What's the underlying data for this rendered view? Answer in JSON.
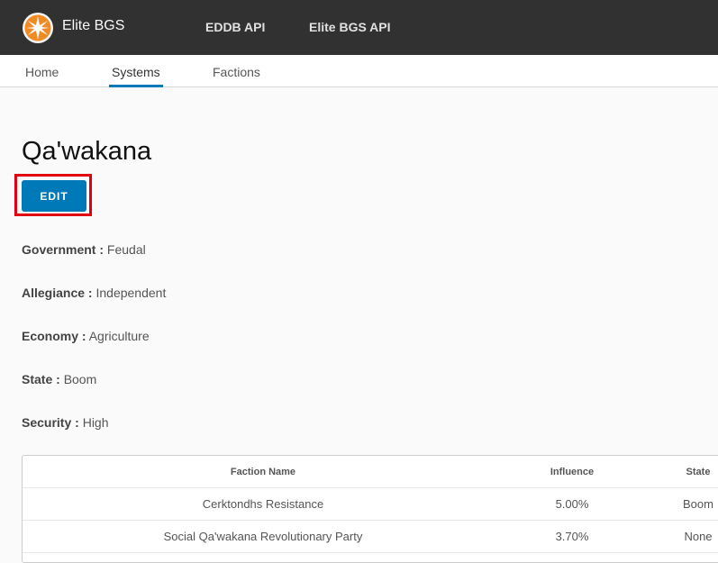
{
  "header": {
    "brand": "Elite BGS",
    "links": [
      "EDDB API",
      "Elite BGS API"
    ]
  },
  "tabs": [
    "Home",
    "Systems",
    "Factions"
  ],
  "active_tab": "Systems",
  "system": {
    "name": "Qa'wakana",
    "edit_label": "EDIT",
    "attributes": [
      {
        "label": "Government :",
        "value": "Feudal"
      },
      {
        "label": "Allegiance :",
        "value": "Independent"
      },
      {
        "label": "Economy :",
        "value": "Agriculture"
      },
      {
        "label": "State :",
        "value": "Boom"
      },
      {
        "label": "Security :",
        "value": "High"
      }
    ]
  },
  "table": {
    "columns": [
      "Faction Name",
      "Influence",
      "State"
    ],
    "rows": [
      {
        "name": "Cerktondhs Resistance",
        "influence": "5.00%",
        "state": "Boom"
      },
      {
        "name": "Social Qa'wakana Revolutionary Party",
        "influence": "3.70%",
        "state": "None"
      }
    ]
  },
  "colors": {
    "topbar": "#313131",
    "accent": "#0079b8",
    "logo": "#f08a24",
    "highlight": "#e1000f"
  }
}
